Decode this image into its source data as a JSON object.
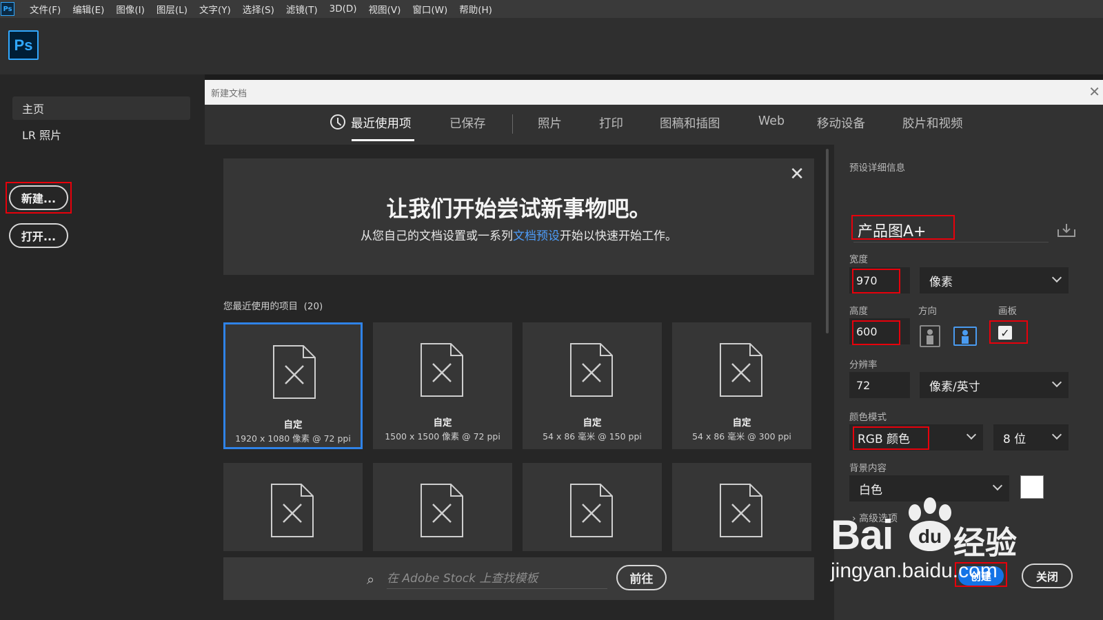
{
  "app": {
    "mini_logo": "Ps",
    "logo": "Ps"
  },
  "menu": [
    "文件(F)",
    "编辑(E)",
    "图像(I)",
    "图层(L)",
    "文字(Y)",
    "选择(S)",
    "滤镜(T)",
    "3D(D)",
    "视图(V)",
    "窗口(W)",
    "帮助(H)"
  ],
  "sidebar": {
    "items": [
      {
        "label": "主页"
      },
      {
        "label": "LR 照片"
      }
    ],
    "new_button": "新建...",
    "open_button": "打开..."
  },
  "dialog": {
    "title": "新建文档",
    "tabs": [
      "最近使用项",
      "已保存",
      "照片",
      "打印",
      "图稿和插图",
      "Web",
      "移动设备",
      "胶片和视频"
    ],
    "banner": {
      "headline": "让我们开始尝试新事物吧。",
      "text_before": "从您自己的文档设置或一系列",
      "link": "文档预设",
      "text_after": "开始以快速开始工作。"
    },
    "recent_label": "您最近使用的项目",
    "recent_count": "(20)",
    "cards": [
      {
        "name": "自定",
        "size": "1920 x 1080 像素 @ 72 ppi"
      },
      {
        "name": "自定",
        "size": "1500 x 1500 像素 @ 72 ppi"
      },
      {
        "name": "自定",
        "size": "54 x 86 毫米 @ 150 ppi"
      },
      {
        "name": "自定",
        "size": "54 x 86 毫米 @ 300 ppi"
      }
    ],
    "stock": {
      "placeholder": "在 Adobe Stock 上查找模板",
      "go_button": "前往"
    }
  },
  "preset": {
    "section_label": "预设详细信息",
    "name": "产品图A+",
    "width_label": "宽度",
    "width_value": "970",
    "width_unit": "像素",
    "height_label": "高度",
    "height_value": "600",
    "orientation_label": "方向",
    "artboard_label": "画板",
    "artboard_checked": "✓",
    "resolution_label": "分辨率",
    "resolution_value": "72",
    "resolution_unit": "像素/英寸",
    "color_mode_label": "颜色模式",
    "color_mode_value": "RGB 颜色",
    "bit_depth": "8 位",
    "background_label": "背景内容",
    "background_value": "白色",
    "advanced_label": "高级选项",
    "create_button": "创建",
    "close_button": "关闭"
  },
  "watermark": {
    "brand": "Bai",
    "brand_tail": "经验",
    "paw_text": "du",
    "url": "jingyan.baidu.com"
  },
  "colors": {
    "accent": "#31a8ff",
    "selection": "#2f83e8",
    "highlight_box": "#e8000b",
    "link": "#4d9dfb"
  }
}
